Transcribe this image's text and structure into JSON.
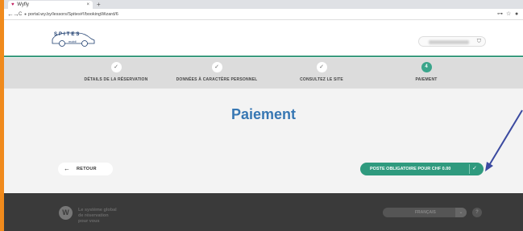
{
  "browser": {
    "tab_title": "Wyfly",
    "tab_close": "×",
    "new_tab": "+",
    "back": "←",
    "forward": "→",
    "reload": "C",
    "lock": "🔒",
    "url": "portal.wy.by/lessors/Spites#!/bookingWizard/6",
    "key_icon": "⊶",
    "star_icon": "☆",
    "profile_icon": "●"
  },
  "header": {
    "logo_text": "SPITES",
    "logo_sub": "mobil",
    "user_icon": "⛉"
  },
  "stepper": {
    "steps": [
      {
        "marker": "✓",
        "label": "DÉTAILS DE LA RÉSERVATION"
      },
      {
        "marker": "✓",
        "label": "DONNÉES À CARACTÈRE PERSONNEL"
      },
      {
        "marker": "✓",
        "label": "CONSULTEZ LE SITE"
      },
      {
        "marker": "4",
        "label": "PAIEMENT"
      }
    ]
  },
  "main": {
    "title": "Paiement",
    "back_arrow": "←",
    "back_label": "RETOUR",
    "pay_label": "POSTE OBLIGATOIRE POUR CHF 0.00",
    "pay_check": "✓"
  },
  "footer": {
    "logo_letter": "W",
    "tagline_1": "Le système global",
    "tagline_2": "de réservation",
    "tagline_3": "pour vous",
    "language": "FRANÇAIS",
    "language_chevron": "⌄",
    "help": "?"
  },
  "colors": {
    "accent_green": "#2f9a7e",
    "title_blue": "#3777b3",
    "annotation_arrow": "#3b4aa0",
    "outer_border": "#f08a1c"
  }
}
